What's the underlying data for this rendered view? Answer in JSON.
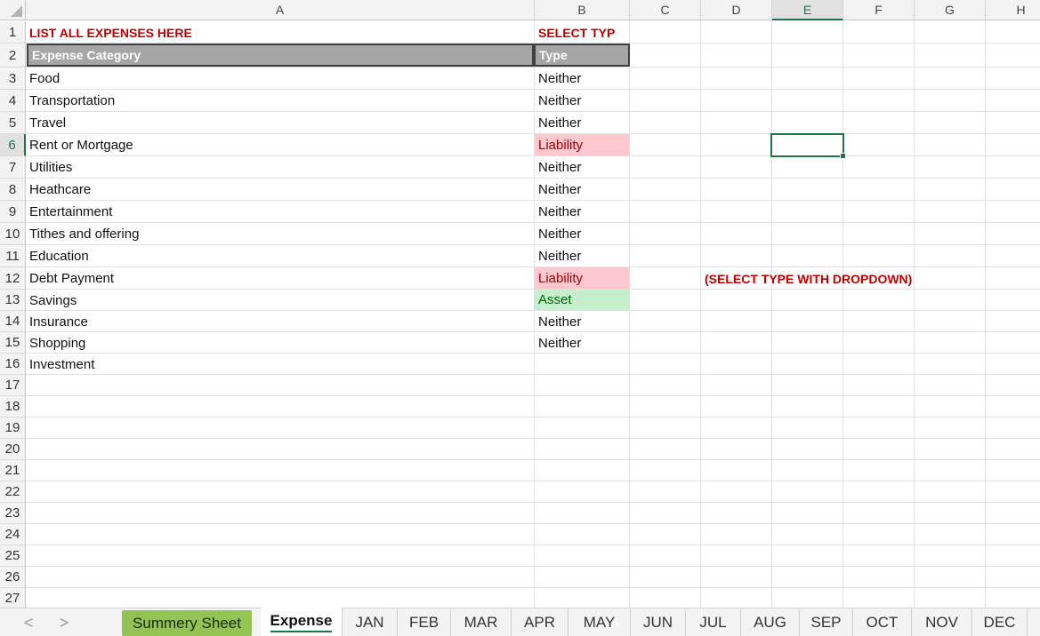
{
  "columns": [
    "A",
    "B",
    "C",
    "D",
    "E",
    "F",
    "G",
    "H"
  ],
  "selected_column": "E",
  "selected_row": "6",
  "rows": [
    "1",
    "2",
    "3",
    "4",
    "5",
    "6",
    "7",
    "8",
    "9",
    "10",
    "11",
    "12",
    "13",
    "14",
    "15",
    "16",
    "17",
    "18",
    "19",
    "20",
    "21",
    "22",
    "23",
    "24",
    "25",
    "26",
    "27"
  ],
  "cells": {
    "a1": "LIST ALL EXPENSES HERE",
    "b1": "SELECT TYP",
    "a2": "Expense Category",
    "b2": "Type",
    "expenses": [
      {
        "category": "Food",
        "type": "Neither"
      },
      {
        "category": "Transportation",
        "type": "Neither"
      },
      {
        "category": "Travel",
        "type": "Neither"
      },
      {
        "category": "Rent or Mortgage",
        "type": "Liability"
      },
      {
        "category": "Utilities",
        "type": "Neither"
      },
      {
        "category": "Heathcare",
        "type": "Neither"
      },
      {
        "category": "Entertainment",
        "type": "Neither"
      },
      {
        "category": "Tithes and offering",
        "type": "Neither"
      },
      {
        "category": "Education",
        "type": "Neither"
      },
      {
        "category": "Debt Payment",
        "type": "Liability"
      },
      {
        "category": "Savings",
        "type": "Asset"
      },
      {
        "category": "Insurance",
        "type": "Neither"
      },
      {
        "category": "Shopping",
        "type": "Neither"
      },
      {
        "category": "Investment",
        "type": ""
      }
    ],
    "note": "(SELECT TYPE WITH DROPDOWN)"
  },
  "colors": {
    "liability_fill": "#ffc7ce",
    "liability_text": "#9c0006",
    "asset_fill": "#c6efce",
    "asset_text": "#006100",
    "accent": "#217346",
    "header_red": "#c00000"
  },
  "sheet_nav": {
    "prev": "<",
    "next": ">"
  },
  "tabs": [
    "Summery Sheet",
    "Expense",
    "JAN",
    "FEB",
    "MAR",
    "APR",
    "MAY",
    "JUN",
    "JUL",
    "AUG",
    "SEP",
    "OCT",
    "NOV",
    "DEC"
  ],
  "active_tab": "Expense"
}
